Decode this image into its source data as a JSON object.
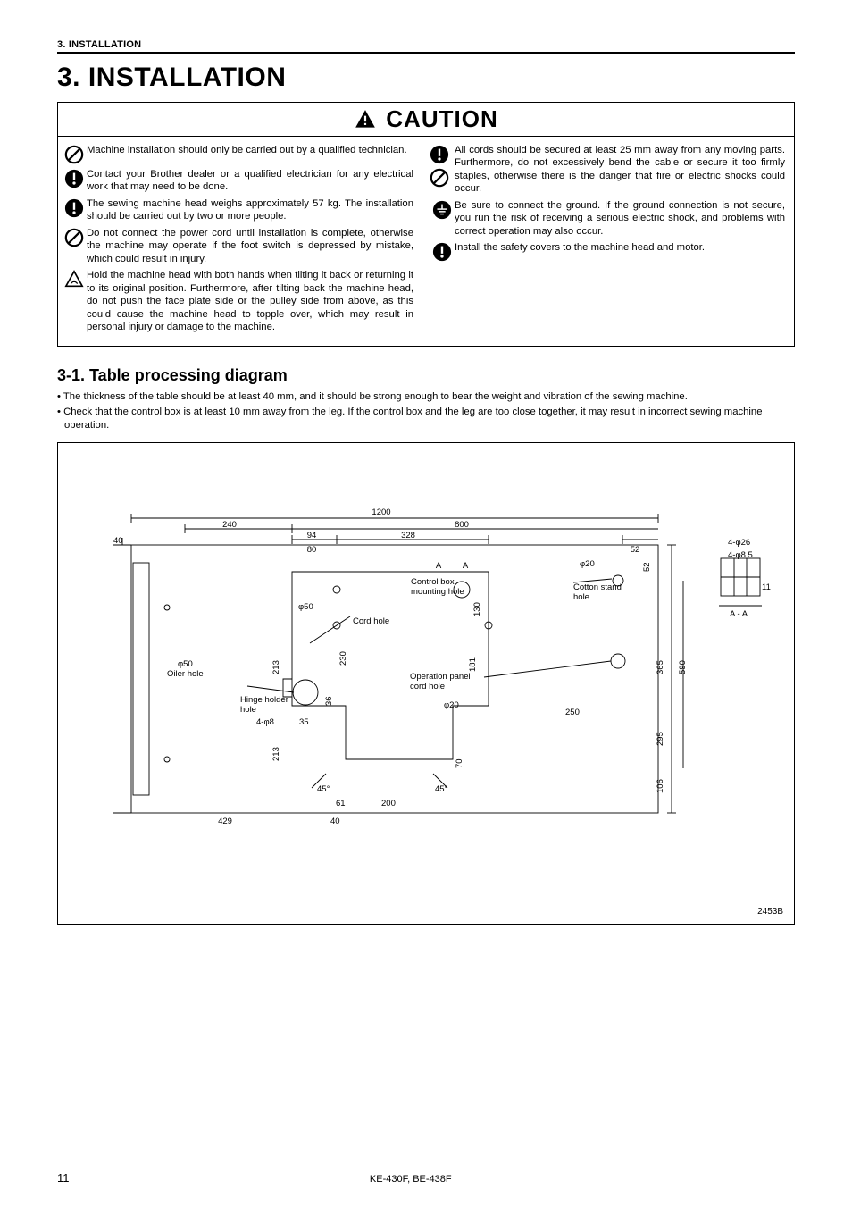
{
  "header": {
    "running": "3. INSTALLATION",
    "chapter": "3. INSTALLATION"
  },
  "caution": {
    "title": "CAUTION",
    "left": [
      {
        "icon": "prohibit",
        "text": "Machine installation should only be carried out by a qualified technician."
      },
      {
        "icon": "mandatory",
        "text": "Contact your Brother dealer or a qualified electrician for any electrical work that may need to be done."
      },
      {
        "icon": "mandatory",
        "text": "The sewing machine head weighs approximately 57 kg. The installation should be carried out by two or more people."
      },
      {
        "icon": "prohibit",
        "text": "Do not connect the power cord until installation is complete, otherwise the machine may operate if the foot switch is depressed by mistake, which could result in injury."
      },
      {
        "icon": "warning",
        "text": "Hold the machine head with both hands when tilting it back or returning it to its original position. Furthermore, after tilting back the machine head, do not push the face plate side or the pulley side from above, as this could cause the machine head to topple over, which may result in personal injury or damage to the machine."
      }
    ],
    "right": [
      {
        "icon": "mandatory",
        "text": "All cords should be secured at least 25 mm away from any moving parts. Furthermore, do not excessively bend the cable or secure it too firmly staples, otherwise there is the danger that fire or electric shocks could occur."
      },
      {
        "icon2": "prohibit",
        "text2": ""
      },
      {
        "icon": "ground",
        "text": "Be sure to connect the ground. If the ground connection is not secure, you run the risk of receiving a serious electric shock, and problems with correct operation may also occur."
      },
      {
        "icon": "mandatory",
        "text": "Install the safety covers to the machine head and motor."
      }
    ]
  },
  "section": {
    "title": "3-1. Table processing diagram",
    "notes": [
      "The thickness of the table should be at least 40 mm, and it should be strong enough to bear the weight and vibration of the sewing machine.",
      "Check that the control box is at least 10 mm away from the leg. If the control box and the leg are too close together, it may result in incorrect sewing machine operation."
    ]
  },
  "diagram": {
    "code": "2453B",
    "labels": {
      "w1200": "1200",
      "w240": "240",
      "w800": "800",
      "w94": "94",
      "w328": "328",
      "w80": "80",
      "w52": "52",
      "phi20a": "φ20",
      "h52": "52",
      "ctrlbox1": "Control box",
      "ctrlbox2": "mounting hole",
      "phi50": "φ50",
      "cordhole": "Cord hole",
      "d130": "130",
      "cotton1": "Cotton stand",
      "cotton2": "hole",
      "oiler1": "φ50",
      "oiler2": "Oiler hole",
      "d213a": "213",
      "d230": "230",
      "op1": "Operation panel",
      "op2": "cord hole",
      "d181": "181",
      "phi20b": "φ20",
      "d365": "365",
      "d590": "590",
      "hinge1": "Hinge holder",
      "hinge2": "hole",
      "d36": "36",
      "d250": "250",
      "d4phi8": "4-φ8",
      "d35": "35",
      "d295": "295",
      "d213b": "213",
      "d106": "106",
      "d70": "70",
      "ang45a": "45°",
      "ang45b": "45°",
      "d61": "61",
      "d200": "200",
      "d429": "429",
      "d40a": "40",
      "d40b": "40",
      "A_top": "A",
      "A_top2": "A",
      "aa": "A - A",
      "d4phi26": "4-φ26",
      "d4phi85": "4-φ8.5",
      "d11": "11"
    }
  },
  "footer": {
    "page": "11",
    "model": "KE-430F, BE-438F"
  }
}
